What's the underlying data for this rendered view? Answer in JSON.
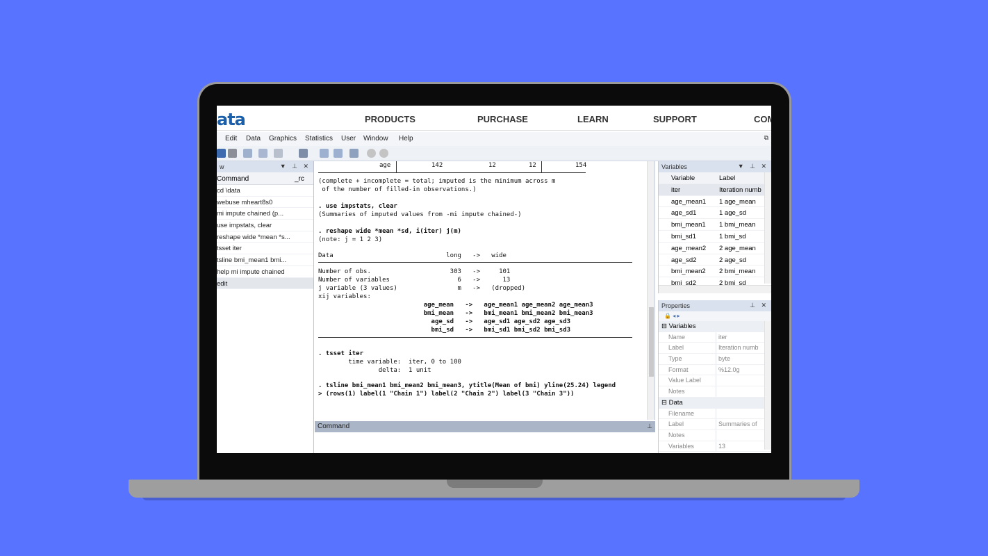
{
  "site_nav": {
    "logo": "ata",
    "links": [
      "PRODUCTS",
      "PURCHASE",
      "LEARN",
      "SUPPORT",
      "COM"
    ]
  },
  "menu": [
    "Edit",
    "Data",
    "Graphics",
    "Statistics",
    "User",
    "Window",
    "Help"
  ],
  "history": {
    "title": "w",
    "col_command": "Command",
    "col_rc": "_rc",
    "items": [
      "cd \\data",
      "webuse mheart8s0",
      "mi impute chained (p...",
      "use impstats, clear",
      "reshape wide *mean *s...",
      "tsset iter",
      "tsline bmi_mean1 bmi...",
      "help mi impute chained",
      "edit"
    ]
  },
  "results": {
    "top_row": {
      "label": "age",
      "v1": "142",
      "v2": "12",
      "v3": "12",
      "v4": "154"
    },
    "lines": [
      "(complete + incomplete = total; imputed is the minimum across m",
      " of the number of filled-in observations.)",
      ". use impstats, clear",
      "(Summaries of imputed values from -mi impute chained-)",
      ". reshape wide *mean *sd, i(iter) j(m)",
      "(note: j = 1 2 3)",
      "Data                              long   ->   wide",
      "Number of obs.                     303   ->     101",
      "Number of variables                  6   ->      13",
      "j variable (3 values)                m   ->   (dropped)",
      "xij variables:",
      "                            age_mean   ->   age_mean1 age_mean2 age_mean3",
      "                            bmi_mean   ->   bmi_mean1 bmi_mean2 bmi_mean3",
      "                              age_sd   ->   age_sd1 age_sd2 age_sd3",
      "                              bmi_sd   ->   bmi_sd1 bmi_sd2 bmi_sd3",
      ". tsset iter",
      "        time variable:  iter, 0 to 100",
      "                delta:  1 unit",
      ". tsline bmi_mean1 bmi_mean2 bmi_mean3, ytitle(Mean of bmi) yline(25.24) legend",
      "> (rows(1) label(1 \"Chain 1\") label(2 \"Chain 2\") label(3 \"Chain 3\"))"
    ]
  },
  "command_pane": {
    "title": "Command",
    "value": ""
  },
  "variables": {
    "title": "Variables",
    "col_variable": "Variable",
    "col_label": "Label",
    "rows": [
      {
        "name": "iter",
        "label": "Iteration numb"
      },
      {
        "name": "age_mean1",
        "label": "1 age_mean"
      },
      {
        "name": "age_sd1",
        "label": "1 age_sd"
      },
      {
        "name": "bmi_mean1",
        "label": "1 bmi_mean"
      },
      {
        "name": "bmi_sd1",
        "label": "1 bmi_sd"
      },
      {
        "name": "age_mean2",
        "label": "2 age_mean"
      },
      {
        "name": "age_sd2",
        "label": "2 age_sd"
      },
      {
        "name": "bmi_mean2",
        "label": "2 bmi_mean"
      },
      {
        "name": "bmi_sd2",
        "label": "2 bmi_sd"
      }
    ]
  },
  "properties": {
    "title": "Properties",
    "sec_variables": "Variables",
    "var_props": [
      {
        "k": "Name",
        "v": "iter"
      },
      {
        "k": "Label",
        "v": "Iteration numb"
      },
      {
        "k": "Type",
        "v": "byte"
      },
      {
        "k": "Format",
        "v": "%12.0g"
      },
      {
        "k": "Value Label",
        "v": ""
      },
      {
        "k": "Notes",
        "v": ""
      }
    ],
    "sec_data": "Data",
    "data_props": [
      {
        "k": "Filename",
        "v": ""
      },
      {
        "k": "Label",
        "v": "Summaries of"
      },
      {
        "k": "Notes",
        "v": ""
      },
      {
        "k": "Variables",
        "v": "13"
      }
    ]
  }
}
